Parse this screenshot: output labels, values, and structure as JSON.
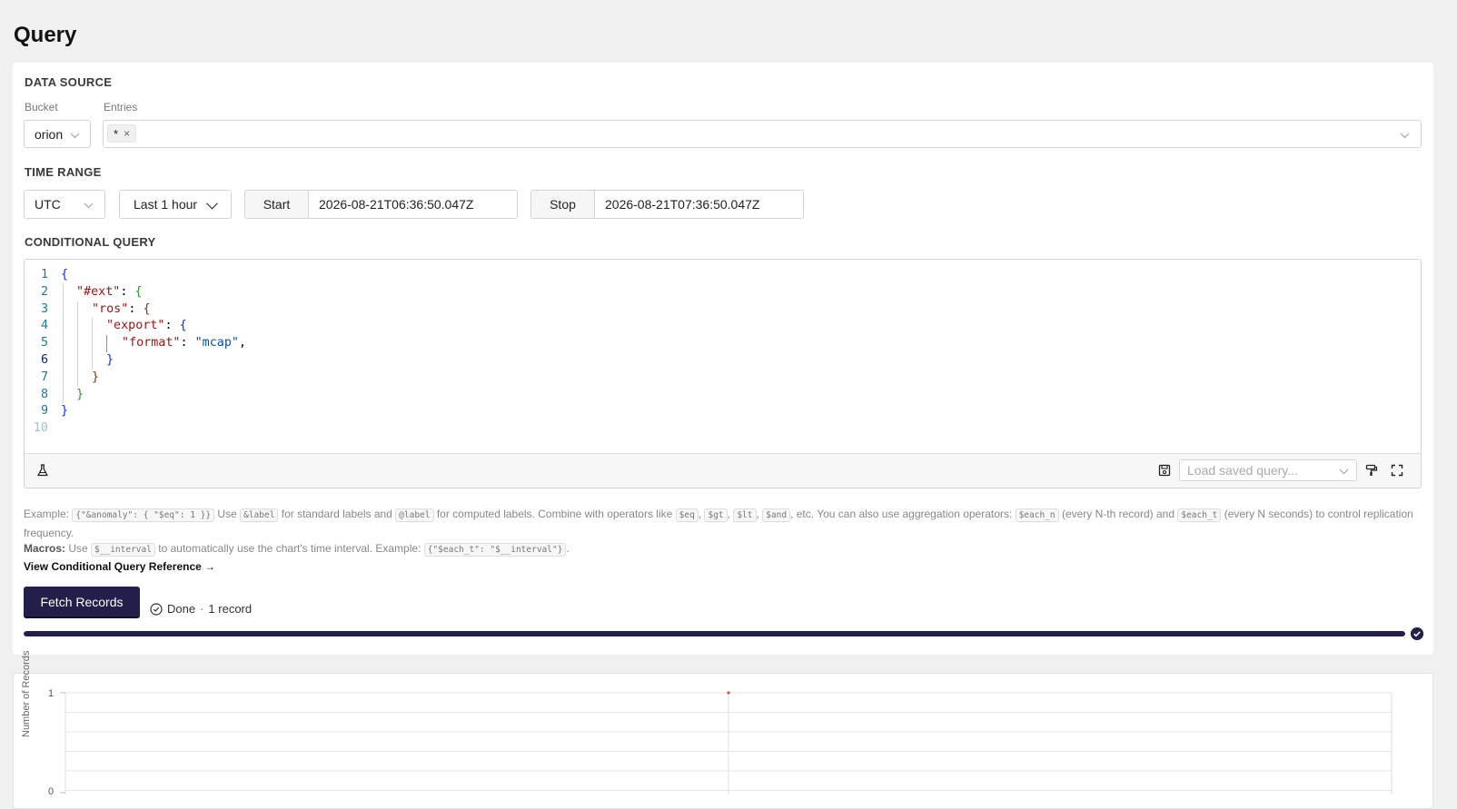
{
  "page": {
    "title": "Query"
  },
  "data_source": {
    "section_title": "DATA SOURCE",
    "bucket_label": "Bucket",
    "bucket_value": "orion",
    "entries_label": "Entries",
    "entries": [
      {
        "label": "*",
        "remove_icon": "×"
      }
    ]
  },
  "time_range": {
    "section_title": "TIME RANGE",
    "timezone": "UTC",
    "preset": "Last 1 hour",
    "start_label": "Start",
    "start_value": "2026-08-21T06:36:50.047Z",
    "stop_label": "Stop",
    "stop_value": "2026-08-21T07:36:50.047Z"
  },
  "conditional_query": {
    "section_title": "CONDITIONAL QUERY",
    "line_numbers": [
      "1",
      "2",
      "3",
      "4",
      "5",
      "6",
      "7",
      "8",
      "9",
      "10"
    ],
    "code": {
      "l1_open": "{",
      "l2_key": "\"#ext\"",
      "l2_colon": ": ",
      "l2_brace": "{",
      "l3_key": "\"ros\"",
      "l3_colon": ": ",
      "l3_brace": "{",
      "l4_key": "\"export\"",
      "l4_colon": ": ",
      "l4_brace": "{",
      "l5_key": "\"format\"",
      "l5_colon": ": ",
      "l5_value": "\"mcap\"",
      "l5_comma": ",",
      "l6_close": "}",
      "l7_close": "}",
      "l8_close": "}",
      "l9_close": "}"
    },
    "toolbar": {
      "test_icon": "flask-icon",
      "save_icon": "floppy-disk-icon",
      "saved_query_placeholder": "Load saved query...",
      "format_icon": "paint-roller-icon",
      "fullscreen_icon": "expand-icon"
    }
  },
  "help": {
    "t1": "Example: ",
    "c1": "{\"&anomaly\": { \"$eq\": 1 }}",
    "t2": " Use ",
    "c2": "&label",
    "t3": " for standard labels and ",
    "c3": "@label",
    "t4": " for computed labels. Combine with operators like ",
    "c4": "$eq",
    "c5": "$gt",
    "c6": "$lt",
    "c7": "$and",
    "t5": ", etc. You can also use aggregation operators: ",
    "c8": "$each_n",
    "t6": " (every N-th record) and ",
    "c9": "$each_t",
    "t7": " (every N seconds) to control replication frequency.",
    "macros_label": "Macros:",
    "m1": " Use ",
    "mc1": "$__interval",
    "m2": " to automatically use the chart's time interval. Example: ",
    "mc2": "{\"$each_t\": \"$__interval\"}",
    "m3": ".",
    "reference_link": "View Conditional Query Reference →"
  },
  "actions": {
    "fetch_button": "Fetch Records",
    "status_text": "Done",
    "status_separator": "·",
    "record_count": "1 record",
    "progress": 1.0
  },
  "chart_data": {
    "type": "line",
    "ylabel": "Number of Records",
    "ylim": [
      0,
      1
    ],
    "y_ticks": [
      "1",
      "0"
    ],
    "points": [
      {
        "x_fraction_of_range": 0.5,
        "y": 1
      }
    ],
    "colors": {
      "series": "#d9531e",
      "progress": "#22204a"
    }
  }
}
